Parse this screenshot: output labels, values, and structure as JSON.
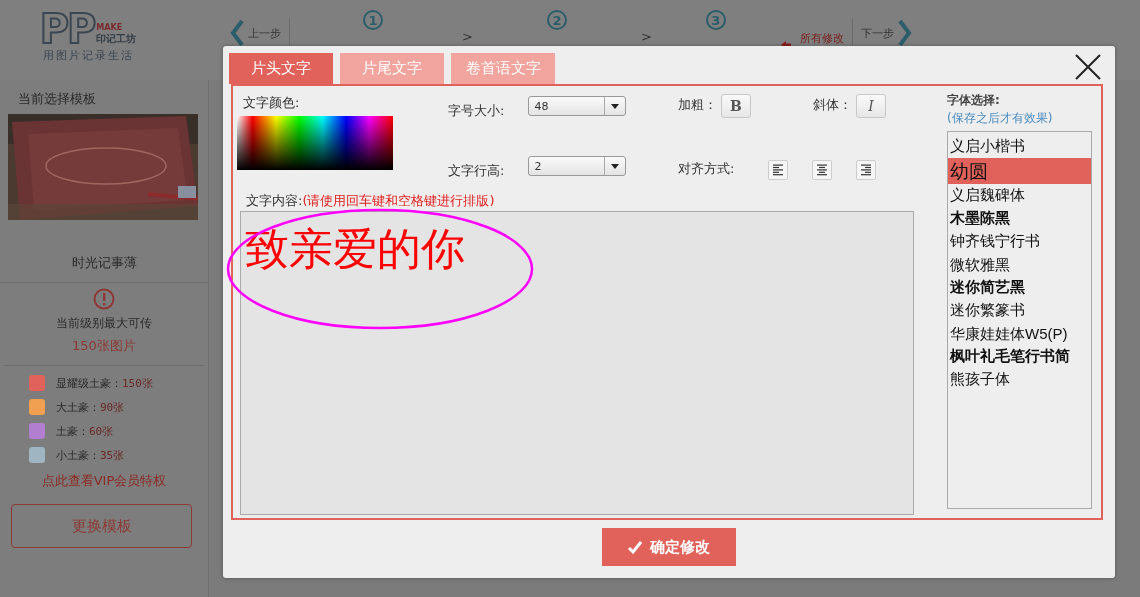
{
  "header": {
    "logo": {
      "letters": "PP",
      "make": "MAKE",
      "brand": "印记工坊",
      "slogan": "用图片记录生活"
    },
    "prev": "上一步",
    "steps": [
      {
        "number": "1"
      },
      {
        "number": "2"
      },
      {
        "number": "3"
      }
    ],
    "separator": ">",
    "save_notice": [
      "所有修改"
    ],
    "next": "下一步"
  },
  "sidebar": {
    "title": "当前选择模板",
    "template_name": "时光记事薄",
    "limit": [
      "当前级别最大可传",
      "150张图片"
    ],
    "levels": [
      {
        "name": "显耀级土豪：",
        "count": "150张",
        "color": "#e0625a"
      },
      {
        "name": "大土豪：",
        "count": "90张",
        "color": "#f0a050"
      },
      {
        "name": "土豪：",
        "count": "60张",
        "color": "#b27fd0"
      },
      {
        "name": "小土豪：",
        "count": "35张",
        "color": "#9fb5c2"
      }
    ],
    "vip_link": "点此查看VIP会员特权",
    "change_button": "更换模板"
  },
  "dialog": {
    "tabs": [
      {
        "label": "片头文字",
        "selected": true
      },
      {
        "label": "片尾文字",
        "selected": false
      },
      {
        "label": "卷首语文字",
        "selected": false
      }
    ],
    "color_label": "文字颜色:",
    "size": {
      "label": "字号大小:",
      "value": "48"
    },
    "bold": {
      "label": "加粗：",
      "glyph": "B"
    },
    "italic": {
      "label": "斜体：",
      "glyph": "I"
    },
    "line_height": {
      "label": "文字行高:",
      "value": "2"
    },
    "align": {
      "label": "对齐方式:"
    },
    "content": {
      "label": "文字内容:",
      "hint": "(请使用回车键和空格键进行排版)",
      "value": "致亲爱的你"
    },
    "fonts": {
      "title": "字体选择:",
      "note": "(保存之后才有效果)",
      "items": [
        {
          "name": "义启小楷书",
          "selected": false
        },
        {
          "name": "幼圆",
          "selected": true
        },
        {
          "name": "义启魏碑体",
          "selected": false
        },
        {
          "name": "木墨陈黑",
          "selected": false
        },
        {
          "name": "钟齐钱宁行书",
          "selected": false
        },
        {
          "name": "微软雅黑",
          "selected": false
        },
        {
          "name": "迷你简艺黑",
          "selected": false
        },
        {
          "name": "迷你繁篆书",
          "selected": false
        },
        {
          "name": "华康娃娃体W5(P)",
          "selected": false
        },
        {
          "name": "枫叶礼毛笔行书简",
          "selected": false
        },
        {
          "name": "熊孩子体",
          "selected": false
        }
      ]
    },
    "confirm": "确定修改"
  }
}
